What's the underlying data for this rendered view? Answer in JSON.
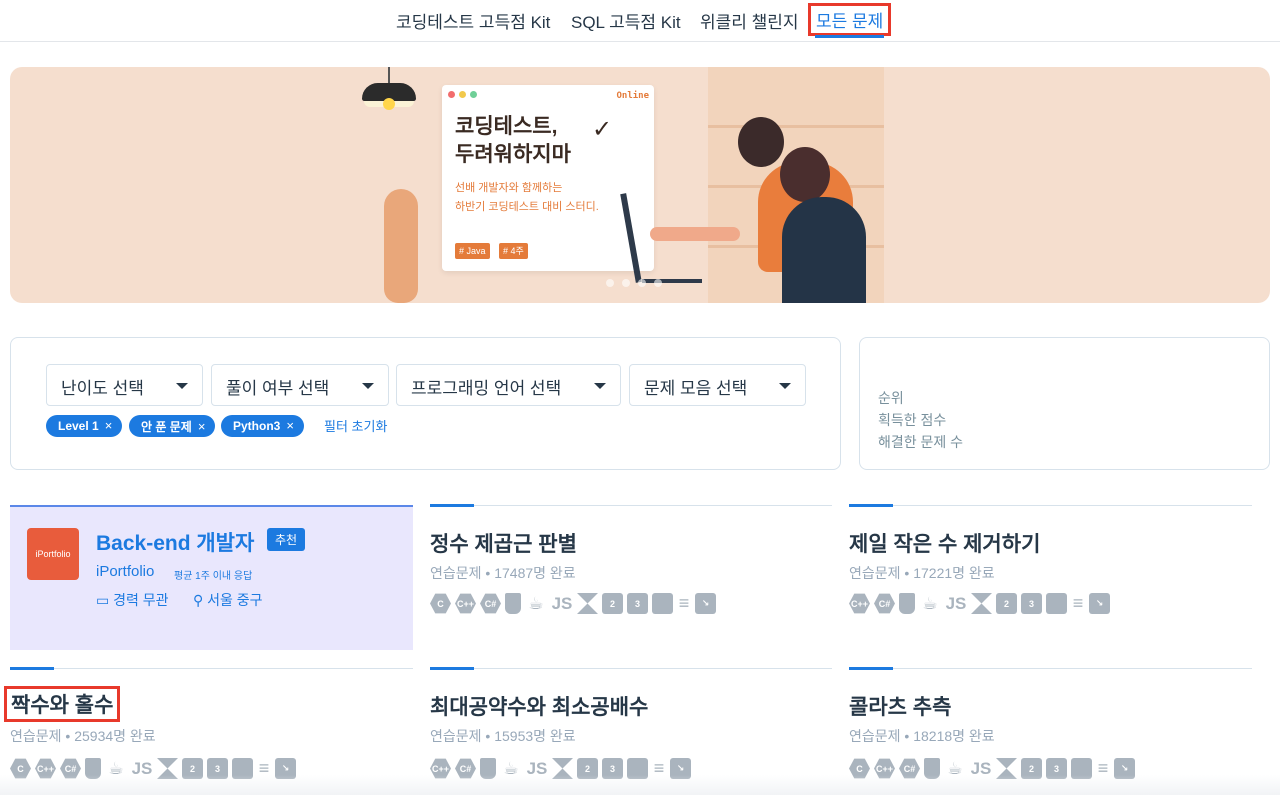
{
  "nav": {
    "items": [
      {
        "label": "코딩테스트 고득점 Kit"
      },
      {
        "label": "SQL 고득점 Kit"
      },
      {
        "label": "위클리 챌린지"
      },
      {
        "label": "모든 문제"
      }
    ]
  },
  "banner": {
    "card_online": "Online",
    "card_title": "코딩테스트,\n두려워하지마",
    "card_check": "✓",
    "card_desc": "선배 개발자와 함께하는\n하반기 코딩테스트 대비 스터디.",
    "tags": [
      "# Java",
      "# 4주"
    ]
  },
  "filters": {
    "selects": [
      {
        "label": "난이도 선택"
      },
      {
        "label": "풀이 여부 선택"
      },
      {
        "label": "프로그래밍 언어 선택"
      },
      {
        "label": "문제 모음 선택"
      }
    ],
    "chips": [
      {
        "label": "Level 1"
      },
      {
        "label": "안 푼 문제"
      },
      {
        "label": "Python3"
      }
    ],
    "chip_remove": "×",
    "reset": "필터 초기화"
  },
  "rank": {
    "rank_label": "순위",
    "score_label": "획득한 점수",
    "solved_label": "해결한 문제 수"
  },
  "job": {
    "logo_text": "iPortfolio",
    "title": "Back-end 개발자",
    "badge": "추천",
    "company": "iPortfolio",
    "response": "평균 1주 이내 응답",
    "experience": "경력 무관",
    "location": "서울 중구"
  },
  "problems": [
    {
      "title": "정수 제곱근 판별",
      "category": "연습문제",
      "completed": "17487명 완료"
    },
    {
      "title": "제일 작은 수 제거하기",
      "category": "연습문제",
      "completed": "17221명 완료"
    },
    {
      "title": "짝수와 홀수",
      "category": "연습문제",
      "completed": "25934명 완료"
    },
    {
      "title": "최대공약수와 최소공배수",
      "category": "연습문제",
      "completed": "15953명 완료"
    },
    {
      "title": "콜라츠 추측",
      "category": "연습문제",
      "completed": "18218명 완료"
    }
  ],
  "languages_full": [
    {
      "icon": "c-icon",
      "glyph": "C"
    },
    {
      "icon": "cpp-icon",
      "glyph": "C++"
    },
    {
      "icon": "csharp-icon",
      "glyph": "C#"
    },
    {
      "icon": "go-icon",
      "glyph": ""
    },
    {
      "icon": "java-icon",
      "glyph": "☕"
    },
    {
      "icon": "javascript-icon",
      "glyph": "JS"
    },
    {
      "icon": "kotlin-icon",
      "glyph": ""
    },
    {
      "icon": "python2-icon",
      "glyph": "2"
    },
    {
      "icon": "python3-icon",
      "glyph": "3"
    },
    {
      "icon": "ruby-icon",
      "glyph": ""
    },
    {
      "icon": "scala-icon",
      "glyph": "≡"
    },
    {
      "icon": "swift-icon",
      "glyph": "↘"
    }
  ],
  "languages_no_c": [
    {
      "icon": "cpp-icon",
      "glyph": "C++"
    },
    {
      "icon": "csharp-icon",
      "glyph": "C#"
    },
    {
      "icon": "go-icon",
      "glyph": ""
    },
    {
      "icon": "java-icon",
      "glyph": "☕"
    },
    {
      "icon": "javascript-icon",
      "glyph": "JS"
    },
    {
      "icon": "kotlin-icon",
      "glyph": ""
    },
    {
      "icon": "python2-icon",
      "glyph": "2"
    },
    {
      "icon": "python3-icon",
      "glyph": "3"
    },
    {
      "icon": "ruby-icon",
      "glyph": ""
    },
    {
      "icon": "scala-icon",
      "glyph": "≡"
    },
    {
      "icon": "swift-icon",
      "glyph": "↘"
    }
  ],
  "colors": {
    "accent": "#1c7ae0",
    "highlight": "#e8392b",
    "banner_bg": "#f5dece",
    "job_bg": "#e9e7fd"
  }
}
